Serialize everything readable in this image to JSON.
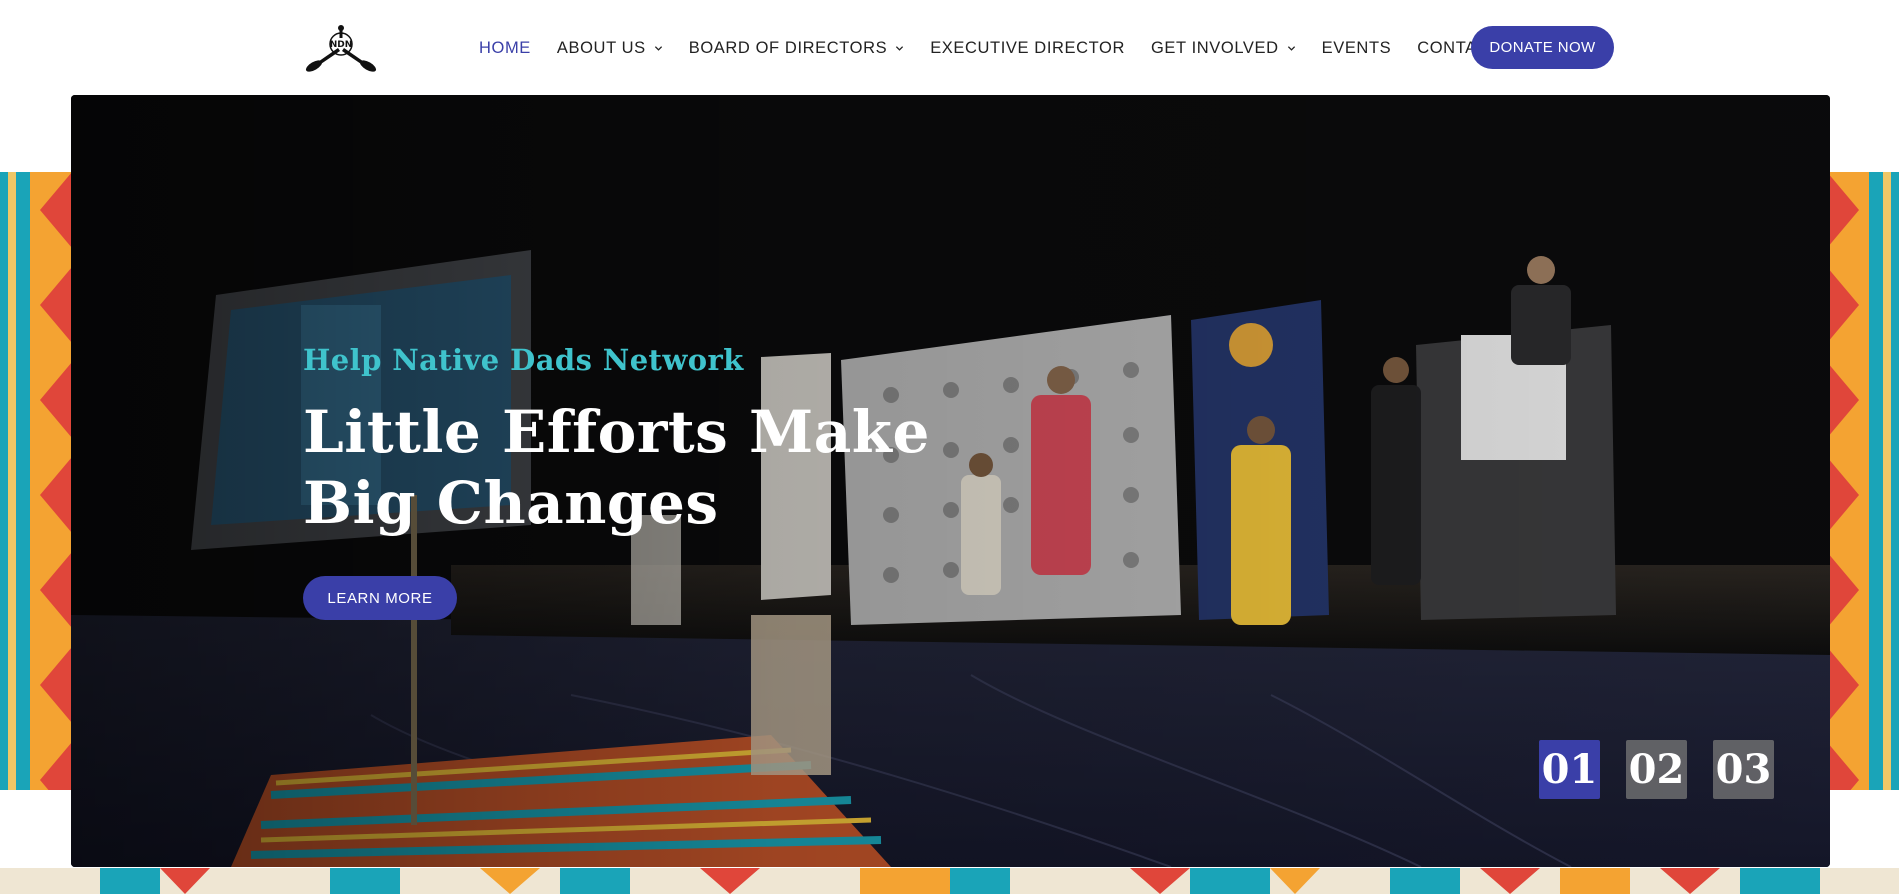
{
  "nav": {
    "logo_text": "NDN",
    "items": [
      {
        "label": "HOME",
        "active": true,
        "has_dropdown": false
      },
      {
        "label": "ABOUT US",
        "active": false,
        "has_dropdown": true
      },
      {
        "label": "BOARD OF DIRECTORS",
        "active": false,
        "has_dropdown": true
      },
      {
        "label": "EXECUTIVE DIRECTOR",
        "active": false,
        "has_dropdown": false
      },
      {
        "label": "GET INVOLVED",
        "active": false,
        "has_dropdown": true
      },
      {
        "label": "EVENTS",
        "active": false,
        "has_dropdown": false
      },
      {
        "label": "CONTACT US",
        "active": false,
        "has_dropdown": false
      }
    ],
    "donate_label": "DONATE NOW"
  },
  "hero": {
    "eyebrow": "Help Native Dads Network",
    "headline": "Little Efforts Make Big Changes",
    "cta_label": "LEARN MORE",
    "slides": [
      {
        "label": "01",
        "active": true
      },
      {
        "label": "02",
        "active": false
      },
      {
        "label": "03",
        "active": false
      }
    ]
  },
  "colors": {
    "primary": "#3a3fa8",
    "eyebrow": "#3fc3cc",
    "pattern_orange": "#f4a332",
    "pattern_red": "#e0463a",
    "pattern_teal": "#1aa4b8"
  }
}
